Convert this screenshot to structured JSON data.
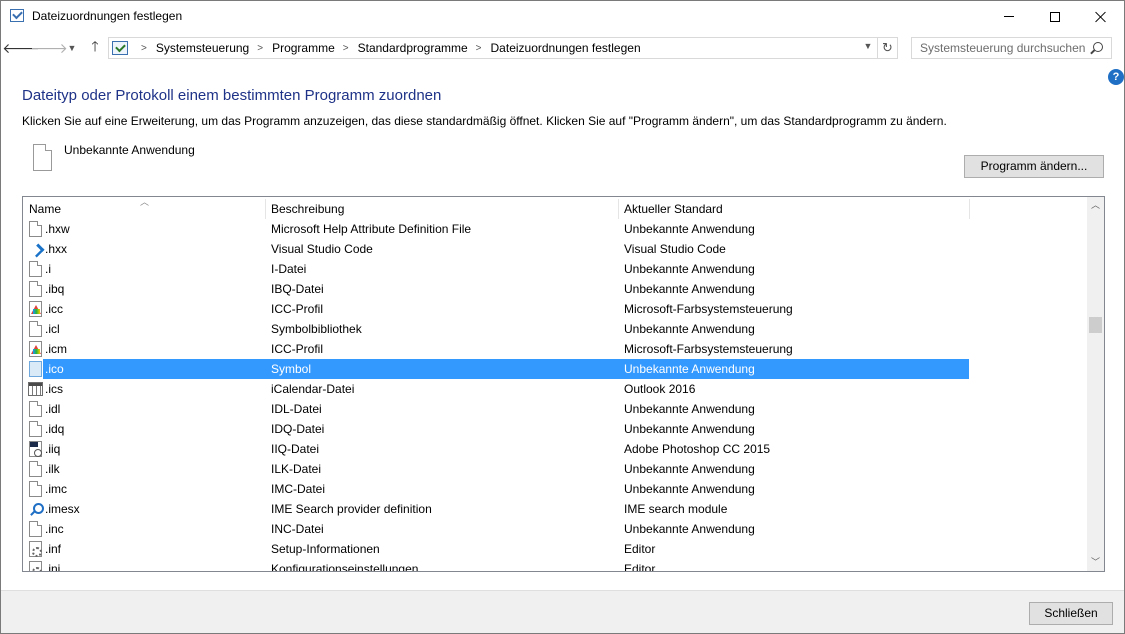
{
  "window": {
    "title": "Dateizuordnungen festlegen"
  },
  "nav": {
    "breadcrumbs": [
      "Systemsteuerung",
      "Programme",
      "Standardprogramme",
      "Dateizuordnungen festlegen"
    ],
    "search_placeholder": "Systemsteuerung durchsuchen"
  },
  "main": {
    "heading": "Dateityp oder Protokoll einem bestimmten Programm zuordnen",
    "description": "Klicken Sie auf eine Erweiterung, um das Programm anzuzeigen, das diese standardmäßig öffnet. Klicken Sie auf \"Programm ändern\", um das Standardprogramm zu ändern.",
    "current_app": "Unbekannte Anwendung",
    "change_button": "Programm ändern..."
  },
  "list": {
    "columns": [
      "Name",
      "Beschreibung",
      "Aktueller Standard"
    ],
    "selected_index": 7,
    "rows": [
      {
        "name": ".hxw",
        "description": "Microsoft Help Attribute Definition File",
        "default": "Unbekannte Anwendung",
        "icon": "generic-file-icon"
      },
      {
        "name": ".hxx",
        "description": "Visual Studio Code",
        "default": "Visual Studio Code",
        "icon": "vscode-icon"
      },
      {
        "name": ".i",
        "description": "I-Datei",
        "default": "Unbekannte Anwendung",
        "icon": "generic-file-icon"
      },
      {
        "name": ".ibq",
        "description": "IBQ-Datei",
        "default": "Unbekannte Anwendung",
        "icon": "generic-file-icon"
      },
      {
        "name": ".icc",
        "description": "ICC-Profil",
        "default": "Microsoft-Farbsystemsteuerung",
        "icon": "color-profile-icon"
      },
      {
        "name": ".icl",
        "description": "Symbolbibliothek",
        "default": "Unbekannte Anwendung",
        "icon": "generic-file-icon"
      },
      {
        "name": ".icm",
        "description": "ICC-Profil",
        "default": "Microsoft-Farbsystemsteuerung",
        "icon": "color-profile-icon"
      },
      {
        "name": ".ico",
        "description": "Symbol",
        "default": "Unbekannte Anwendung",
        "icon": "ico-file-icon"
      },
      {
        "name": ".ics",
        "description": "iCalendar-Datei",
        "default": "Outlook 2016",
        "icon": "calendar-icon"
      },
      {
        "name": ".idl",
        "description": "IDL-Datei",
        "default": "Unbekannte Anwendung",
        "icon": "generic-file-icon"
      },
      {
        "name": ".idq",
        "description": "IDQ-Datei",
        "default": "Unbekannte Anwendung",
        "icon": "generic-file-icon"
      },
      {
        "name": ".iiq",
        "description": "IIQ-Datei",
        "default": "Adobe Photoshop CC 2015",
        "icon": "photoshop-file-icon"
      },
      {
        "name": ".ilk",
        "description": "ILK-Datei",
        "default": "Unbekannte Anwendung",
        "icon": "generic-file-icon"
      },
      {
        "name": ".imc",
        "description": "IMC-Datei",
        "default": "Unbekannte Anwendung",
        "icon": "generic-file-icon"
      },
      {
        "name": ".imesx",
        "description": "IME Search provider definition",
        "default": "IME search module",
        "icon": "search-provider-icon"
      },
      {
        "name": ".inc",
        "description": "INC-Datei",
        "default": "Unbekannte Anwendung",
        "icon": "generic-file-icon"
      },
      {
        "name": ".inf",
        "description": "Setup-Informationen",
        "default": "Editor",
        "icon": "setup-file-icon"
      },
      {
        "name": ".ini",
        "description": "Konfigurationseinstellungen",
        "default": "Editor",
        "icon": "setup-file-icon"
      }
    ]
  },
  "footer": {
    "close_button": "Schließen"
  },
  "colors": {
    "heading": "#1e3287",
    "selection": "#3399ff",
    "help": "#1f6fc5"
  }
}
